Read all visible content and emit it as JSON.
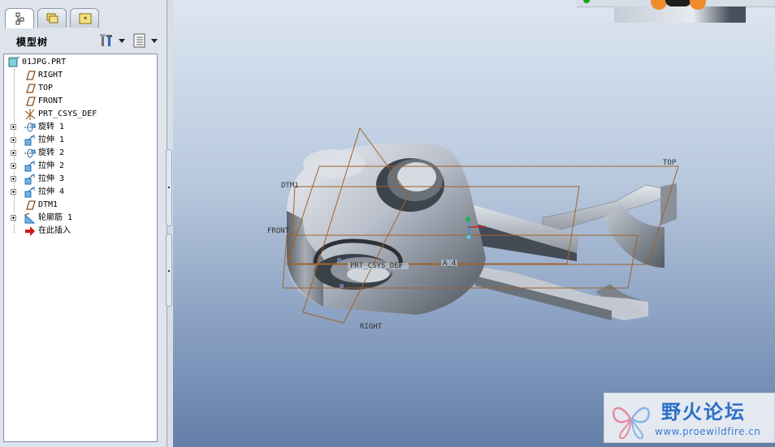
{
  "left_panel": {
    "tabs": [
      {
        "name": "model-tree-tab",
        "icon": "tree-structure-icon"
      },
      {
        "name": "folder-browser-tab",
        "icon": "folders-icon"
      },
      {
        "name": "favorites-tab",
        "icon": "star-icon"
      }
    ],
    "title": "模型树",
    "settings_icon": "tools-icon",
    "show_icon": "list-icon",
    "tree": {
      "root": {
        "label": "01JPG.PRT",
        "icon": "part-icon"
      },
      "items": [
        {
          "label": "RIGHT",
          "icon": "datum-plane-icon",
          "expandable": false
        },
        {
          "label": "TOP",
          "icon": "datum-plane-icon",
          "expandable": false
        },
        {
          "label": "FRONT",
          "icon": "datum-plane-icon",
          "expandable": false
        },
        {
          "label": "PRT_CSYS_DEF",
          "icon": "coordinate-system-icon",
          "expandable": false
        },
        {
          "label": "旋转 1",
          "icon": "revolve-icon",
          "expandable": true
        },
        {
          "label": "拉伸 1",
          "icon": "extrude-icon",
          "expandable": true
        },
        {
          "label": "旋转 2",
          "icon": "revolve-icon",
          "expandable": true
        },
        {
          "label": "拉伸 2",
          "icon": "extrude-icon",
          "expandable": true
        },
        {
          "label": "拉伸 3",
          "icon": "extrude-icon",
          "expandable": true
        },
        {
          "label": "拉伸 4",
          "icon": "extrude-icon",
          "expandable": true
        },
        {
          "label": "DTM1",
          "icon": "datum-plane-icon",
          "expandable": false
        },
        {
          "label": "轮廓筋 1",
          "icon": "profile-rib-icon",
          "expandable": true
        },
        {
          "label": "在此插入",
          "icon": "insert-here-arrow-icon",
          "expandable": false
        }
      ]
    }
  },
  "graphics": {
    "datum_labels": {
      "top": "TOP",
      "dtm1": "DTM1",
      "front": "FRONT",
      "right": "RIGHT",
      "csys": "PRT_CSYS_DEF",
      "axis": "A_4"
    },
    "colors": {
      "datum_plane": "#a0622a",
      "background_top": "#dde6f2",
      "background_bottom": "#637fa8"
    }
  },
  "watermark": {
    "title": "野火论坛",
    "url": "www.proewildfire.cn",
    "logo_icon": "butterfly-logo-icon"
  }
}
